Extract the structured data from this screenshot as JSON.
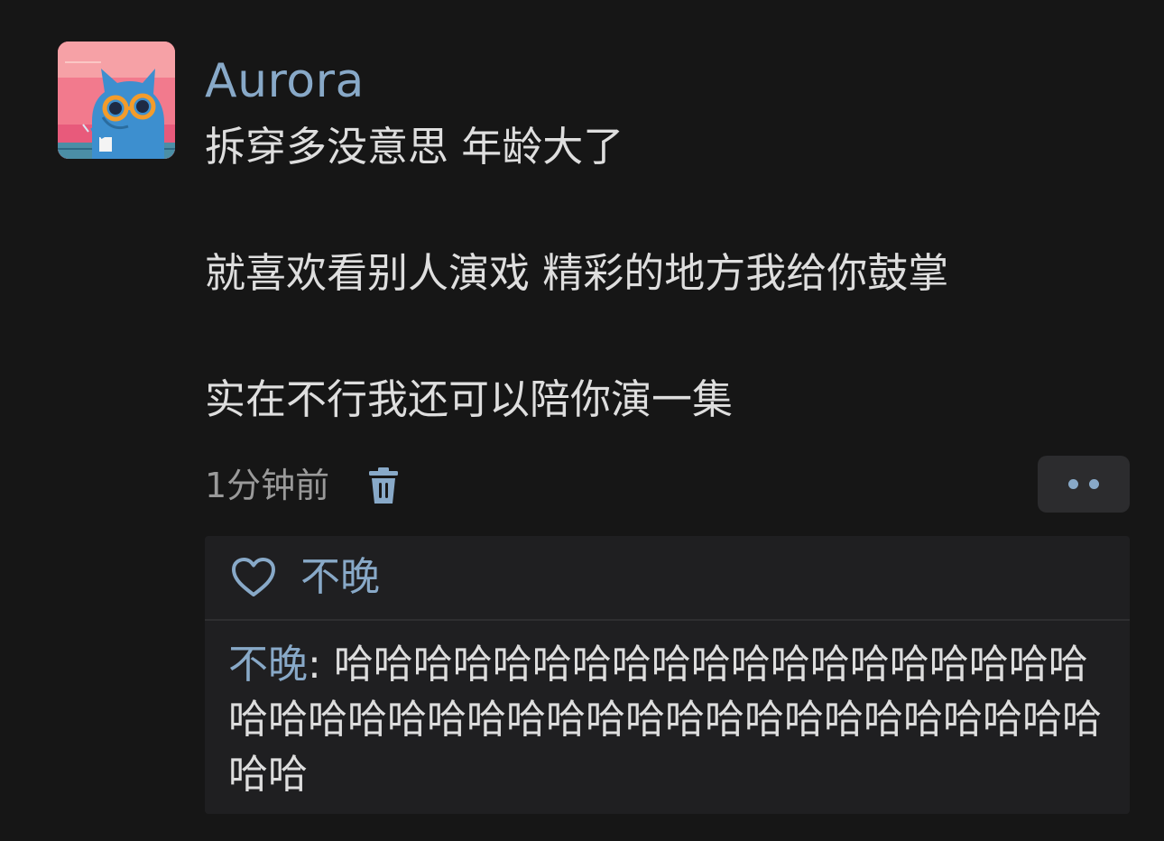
{
  "post": {
    "username": "Aurora",
    "lines": [
      "拆穿多没意思 年龄大了",
      "就喜欢看别人演戏 精彩的地方我给你鼓掌",
      "实在不行我还可以陪你演一集"
    ],
    "time": "1分钟前",
    "delete_icon": "trash-icon",
    "more_icon": "more-dots-icon"
  },
  "likes": {
    "icon": "heart-icon",
    "names": "不晚"
  },
  "reply": {
    "author": "不晚",
    "separator": ": ",
    "text": "哈哈哈哈哈哈哈哈哈哈哈哈哈哈哈哈哈哈哈哈哈哈哈哈哈哈哈哈哈哈哈哈哈哈哈哈哈哈哈哈哈哈哈"
  },
  "colors": {
    "background": "#161616",
    "accent": "#88a9c8",
    "text": "#dedede",
    "muted": "#9a9a9a",
    "panel": "#1f1f21"
  }
}
